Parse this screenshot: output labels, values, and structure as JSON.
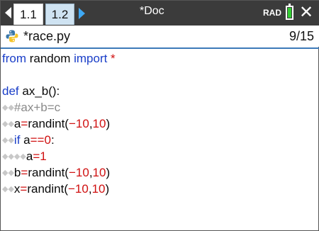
{
  "topbar": {
    "tabs": [
      "1.1",
      "1.2"
    ],
    "doc_title": "*Doc",
    "angle_mode": "RAD",
    "battery_color": "#33cc33"
  },
  "file": {
    "name": "*race.py",
    "position": "9/15"
  },
  "code": {
    "line1": {
      "kw1": "from",
      "mid": " random ",
      "kw2": "import",
      "star": " *"
    },
    "line3": {
      "kw": "def",
      "rest": " ax_b():"
    },
    "line4": {
      "indent": "◆◆",
      "comment": "#ax+b=c"
    },
    "line5": {
      "indent": "◆◆",
      "a": "a",
      "eq": "=",
      "call": "randint(",
      "n1": "−10",
      "sep": ",",
      "n2": "10",
      "close": ")"
    },
    "line6": {
      "indent": "◆◆",
      "kw": "if",
      "a": " a",
      "op": "==",
      "n": "0",
      "colon": ":"
    },
    "line7": {
      "indent": "◆◆◆◆",
      "a": "a",
      "eq": "=",
      "n": "1"
    },
    "line8": {
      "indent": "◆◆",
      "b": "b",
      "eq": "=",
      "call": "randint(",
      "n1": "−10",
      "sep": ",",
      "n2": "10",
      "close": ")"
    },
    "line9": {
      "indent": "◆◆",
      "x": "x",
      "eq": "=",
      "call": "randint(",
      "n1": "−10",
      "sep": ",",
      "n2": "10",
      "close": ")"
    }
  }
}
